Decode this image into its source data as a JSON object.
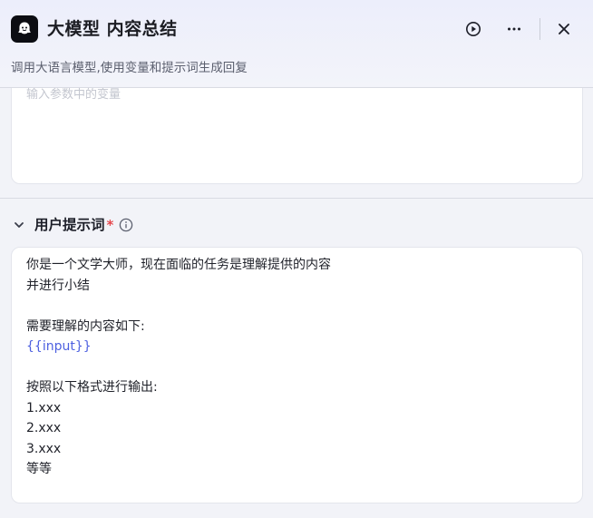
{
  "header": {
    "title": "大模型 内容总结",
    "subtitle": "调用大语言模型,使用变量和提示词生成回复",
    "actions": {
      "run_icon": "play-circle-icon",
      "more_icon": "more-horizontal-icon",
      "close_icon": "close-icon"
    }
  },
  "input_params": {
    "placeholder": "输入参数中的变量"
  },
  "user_prompt": {
    "label": "用户提示词",
    "required_mark": "*",
    "lines": [
      "你是一个文学大师，现在面临的任务是理解提供的内容",
      "并进行小结",
      "",
      "需要理解的内容如下:",
      "{{input}}",
      "",
      "按照以下格式进行输出:",
      "1.xxx",
      "2.xxx",
      "3.xxx",
      "等等"
    ]
  },
  "colors": {
    "accent_variable": "#4d60e0",
    "required": "#e5484d"
  }
}
